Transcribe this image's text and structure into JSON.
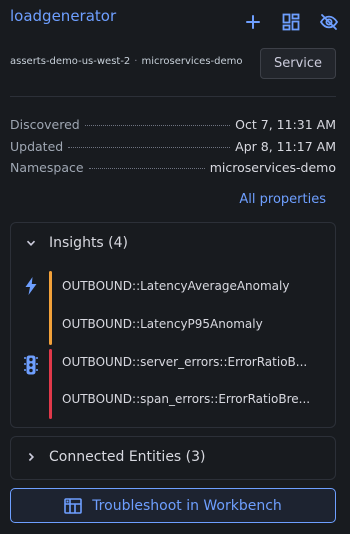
{
  "header": {
    "title": "loadgenerator",
    "icons": [
      "plus-icon",
      "dashboard-grid-icon",
      "eye-slash-icon"
    ]
  },
  "subheader": {
    "cluster": "asserts-demo-us-west-2",
    "separator": "·",
    "env": "microservices-demo",
    "type_button": "Service"
  },
  "properties": [
    {
      "key": "Discovered",
      "value": "Oct 7, 11:31 AM"
    },
    {
      "key": "Updated",
      "value": "Apr 8, 11:17 AM"
    },
    {
      "key": "Namespace",
      "value": "microservices-demo"
    }
  ],
  "all_properties_link": "All properties",
  "insights": {
    "title": "Insights (4)",
    "groups": [
      {
        "icon": "lightning-bolt-icon",
        "color": "#f2a13a",
        "items": [
          "OUTBOUND::LatencyAverageAnomaly",
          "OUTBOUND::LatencyP95Anomaly"
        ]
      },
      {
        "icon": "traffic-light-icon",
        "color": "#e0394a",
        "items": [
          "OUTBOUND::server_errors::ErrorRatioB...",
          "OUTBOUND::span_errors::ErrorRatioBre..."
        ]
      }
    ]
  },
  "connected_entities": {
    "title": "Connected Entities (3)"
  },
  "workbench_button": "Troubleshoot in Workbench",
  "colors": {
    "accent": "#6e9fff",
    "background": "#181b1f",
    "warning": "#f2a13a",
    "error": "#e0394a"
  }
}
